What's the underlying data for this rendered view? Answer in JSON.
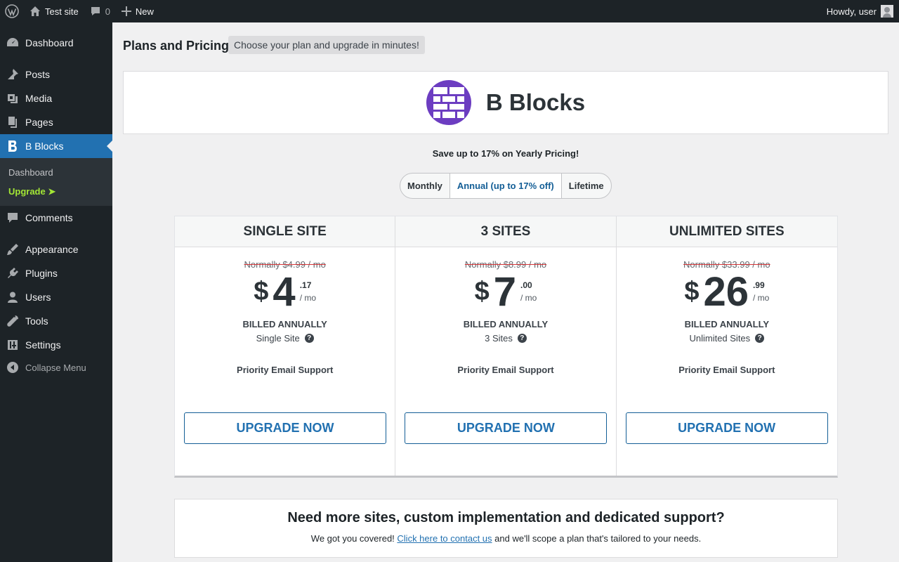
{
  "admin_bar": {
    "site_name": "Test site",
    "comments_count": "0",
    "new_label": "New",
    "greeting": "Howdy, user"
  },
  "sidebar": {
    "items": [
      {
        "label": "Dashboard",
        "icon": "dashboard-icon"
      },
      {
        "label": "Posts",
        "icon": "pin-icon"
      },
      {
        "label": "Media",
        "icon": "media-icon"
      },
      {
        "label": "Pages",
        "icon": "pages-icon"
      },
      {
        "label": "B Blocks",
        "icon": "b-blocks-icon",
        "current": true
      },
      {
        "label": "Comments",
        "icon": "comment-icon"
      },
      {
        "label": "Appearance",
        "icon": "brush-icon"
      },
      {
        "label": "Plugins",
        "icon": "plugin-icon"
      },
      {
        "label": "Users",
        "icon": "user-icon"
      },
      {
        "label": "Tools",
        "icon": "wrench-icon"
      },
      {
        "label": "Settings",
        "icon": "settings-icon"
      }
    ],
    "submenu": [
      {
        "label": "Dashboard"
      },
      {
        "label": "Upgrade ➤"
      }
    ],
    "collapse_label": "Collapse Menu"
  },
  "page": {
    "title": "Plans and Pricing",
    "tagline": "Choose your plan and upgrade in minutes!",
    "brand_name": "B Blocks",
    "save_note": "Save up to 17% on Yearly Pricing!",
    "billing_options": [
      "Monthly",
      "Annual (up to 17% off)",
      "Lifetime"
    ],
    "selected_billing": "Annual (up to 17% off)"
  },
  "plans": [
    {
      "name": "SINGLE SITE",
      "normally": "Normally $4.99 / mo",
      "currency": "$",
      "amount": "4",
      "cents": ".17",
      "period": "/ mo",
      "billed": "BILLED ANNUALLY",
      "sites": "Single Site",
      "support": "Priority Email Support",
      "cta": "UPGRADE NOW"
    },
    {
      "name": "3 SITES",
      "normally": "Normally $8.99 / mo",
      "currency": "$",
      "amount": "7",
      "cents": ".00",
      "period": "/ mo",
      "billed": "BILLED ANNUALLY",
      "sites": "3 Sites",
      "support": "Priority Email Support",
      "cta": "UPGRADE NOW"
    },
    {
      "name": "UNLIMITED SITES",
      "normally": "Normally $33.99 / mo",
      "currency": "$",
      "amount": "26",
      "cents": ".99",
      "period": "/ mo",
      "billed": "BILLED ANNUALLY",
      "sites": "Unlimited Sites",
      "support": "Priority Email Support",
      "cta": "UPGRADE NOW"
    }
  ],
  "contact": {
    "title": "Need more sites, custom implementation and dedicated support?",
    "text_before": "We got you covered! ",
    "link": "Click here to contact us",
    "text_after": " and we'll scope a plan that's tailored to your needs."
  },
  "colors": {
    "admin_dark": "#1d2327",
    "accent_blue": "#2271b1",
    "brand_purple": "#6c3dc1",
    "upgrade_green": "#a3e635",
    "strike_red": "#d63638"
  }
}
